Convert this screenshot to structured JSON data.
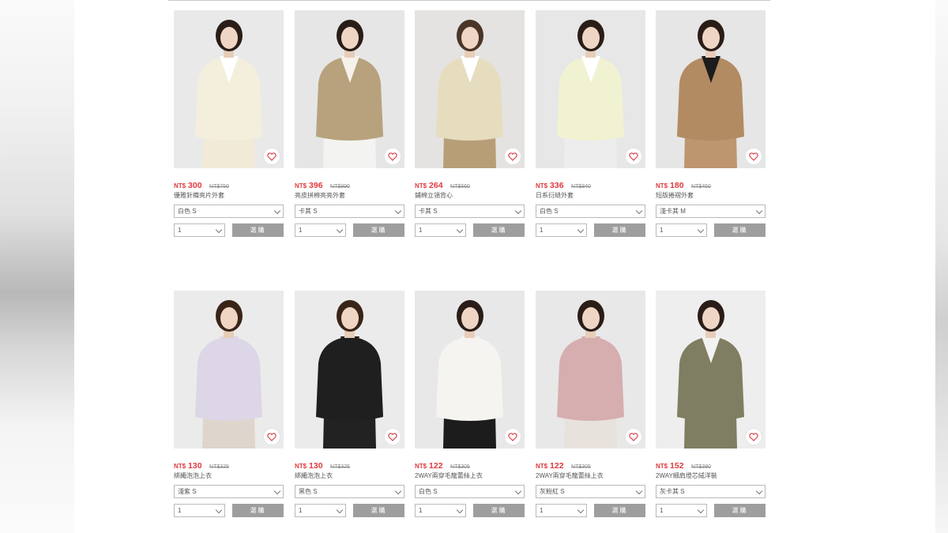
{
  "currency_label": "NT$",
  "buy_label": "選購",
  "colors": {
    "price": "#e03a3e",
    "button": "#9e9e9e"
  },
  "rows": [
    {
      "products": [
        {
          "name": "優雅針織亮片外套",
          "price": "300",
          "old_price": "NT$750",
          "variant": "白色 S",
          "qty": "1",
          "bg": "#e9e9e9",
          "top": "#f3efdc",
          "bottom": "#f0ead6",
          "inner": "#ffffff",
          "hair": "#2a1d17"
        },
        {
          "name": "亮皮拼棉亮亮外套",
          "price": "396",
          "old_price": "NT$990",
          "variant": "卡其 S",
          "qty": "1",
          "bg": "#e6e6e6",
          "top": "#b7a27d",
          "bottom": "#f3f3f1",
          "inner": "#f5f2ea",
          "hair": "#2a1d17"
        },
        {
          "name": "鋪棉立領背心",
          "price": "264",
          "old_price": "NT$660",
          "variant": "卡其 S",
          "qty": "1",
          "bg": "#e4e3e1",
          "top": "#e6ddbf",
          "bottom": "#b89e77",
          "inner": "#ffffff",
          "hair": "#4a3528"
        },
        {
          "name": "日系衍縫外套",
          "price": "336",
          "old_price": "NT$840",
          "variant": "白色 S",
          "qty": "1",
          "bg": "#e7e7e7",
          "top": "#f1f2d2",
          "bottom": "#ededed",
          "inner": "#ffffff",
          "hair": "#2a1d17"
        },
        {
          "name": "短版捲褶外套",
          "price": "180",
          "old_price": "NT$450",
          "variant": "淺卡其 M",
          "qty": "1",
          "bg": "#e6e6e6",
          "top": "#b28b62",
          "bottom": "#bd9670",
          "inner": "#1c1c1c",
          "hair": "#2a1d17"
        }
      ]
    },
    {
      "products": [
        {
          "name": "綁繩泡泡上衣",
          "price": "130",
          "old_price": "NT$325",
          "variant": "淺紫 S",
          "qty": "1",
          "bg": "#ebebeb",
          "top": "#dcd6e6",
          "bottom": "#ded6cc",
          "inner": "#dcd6e6",
          "hair": "#3a2418"
        },
        {
          "name": "綁繩泡泡上衣",
          "price": "130",
          "old_price": "NT$325",
          "variant": "黑色 S",
          "qty": "1",
          "bg": "#ebebeb",
          "top": "#1f1f1f",
          "bottom": "#222222",
          "inner": "#1f1f1f",
          "hair": "#3a2418"
        },
        {
          "name": "2WAY兩穿毛龍蕾絲上衣",
          "price": "122",
          "old_price": "NT$305",
          "variant": "白色 S",
          "qty": "1",
          "bg": "#e8e8e8",
          "top": "#f6f4f0",
          "bottom": "#1c1c1c",
          "inner": "#f6f4f0",
          "hair": "#2a1d17"
        },
        {
          "name": "2WAY兩穿毛龍蕾絲上衣",
          "price": "122",
          "old_price": "NT$305",
          "variant": "灰粉紅 S",
          "qty": "1",
          "bg": "#e8e8e8",
          "top": "#d6aeb0",
          "bottom": "#e8e2dc",
          "inner": "#d6aeb0",
          "hair": "#2a1d17"
        },
        {
          "name": "2WAY細肩燈芯絨洋裝",
          "price": "152",
          "old_price": "NT$380",
          "variant": "灰卡其 S",
          "qty": "1",
          "bg": "#eeeeee",
          "top": "#7f7e62",
          "bottom": "#7f7e62",
          "inner": "#f2f2f2",
          "hair": "#2a1d17"
        }
      ]
    }
  ]
}
